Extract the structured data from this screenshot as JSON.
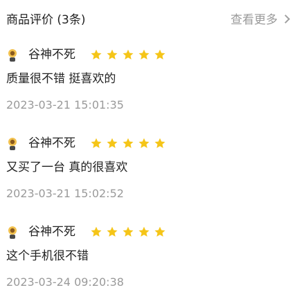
{
  "header": {
    "title": "商品评价 (3条)",
    "see_more_label": "查看更多"
  },
  "colors": {
    "star": "#f5c518",
    "muted_text": "#9a9a9a",
    "main_text": "#222222"
  },
  "reviews": [
    {
      "avatar_icon": "avatar-icon",
      "username": "谷神不死",
      "rating": 5,
      "comment": "质量很不错 挺喜欢的",
      "time": "2023-03-21 15:01:35"
    },
    {
      "avatar_icon": "avatar-icon",
      "username": "谷神不死",
      "rating": 5,
      "comment": "又买了一台 真的很喜欢",
      "time": "2023-03-21 15:02:52"
    },
    {
      "avatar_icon": "avatar-icon",
      "username": "谷神不死",
      "rating": 5,
      "comment": "这个手机很不错",
      "time": "2023-03-24 09:20:38"
    }
  ]
}
